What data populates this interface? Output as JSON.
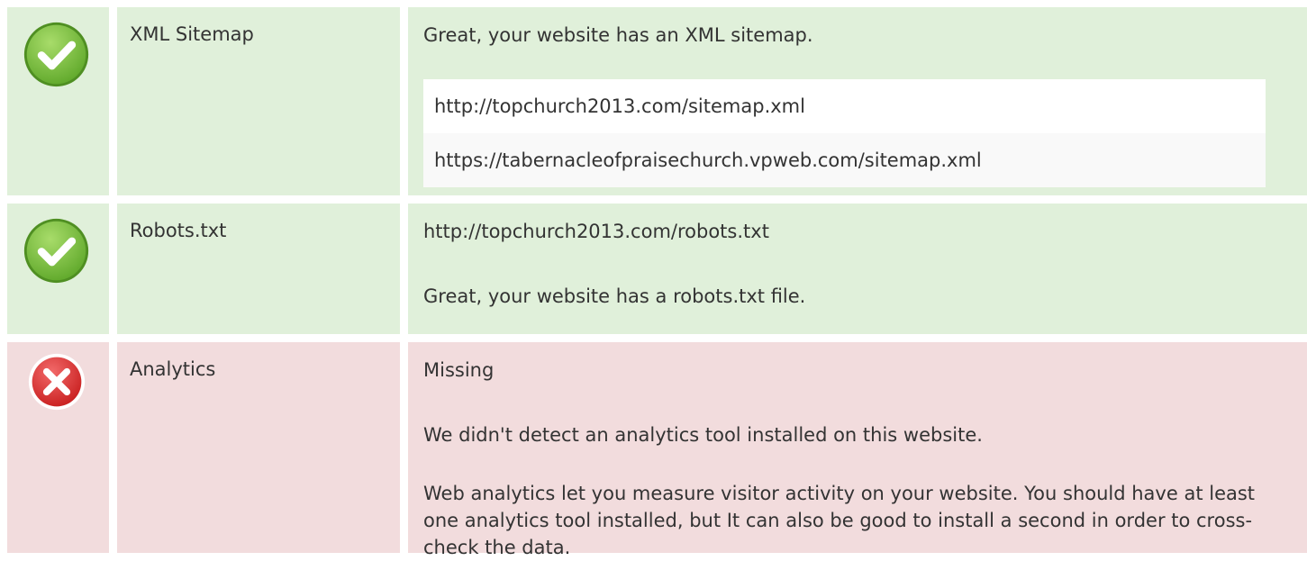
{
  "rows": [
    {
      "status": "pass",
      "icon": "check-icon",
      "name": "XML Sitemap",
      "message": "Great, your website has an XML sitemap.",
      "urls": [
        "http://topchurch2013.com/sitemap.xml",
        "https://tabernacleofpraisechurch.vpweb.com/sitemap.xml"
      ]
    },
    {
      "status": "pass",
      "icon": "check-icon",
      "name": "Robots.txt",
      "url": "http://topchurch2013.com/robots.txt",
      "message": "Great, your website has a robots.txt file."
    },
    {
      "status": "fail",
      "icon": "error-x-icon",
      "name": "Analytics",
      "value": "Missing",
      "message": "We didn't detect an analytics tool installed on this website.",
      "advice": "Web analytics let you measure visitor activity on your website. You should have at least one analytics tool installed, but It can also be good to install a second in order to cross-check the data."
    }
  ],
  "colors": {
    "pass_bg": "#e0f0da",
    "fail_bg": "#f2dcdd",
    "check_green": "#7cc13d",
    "error_red": "#e03a3a"
  }
}
